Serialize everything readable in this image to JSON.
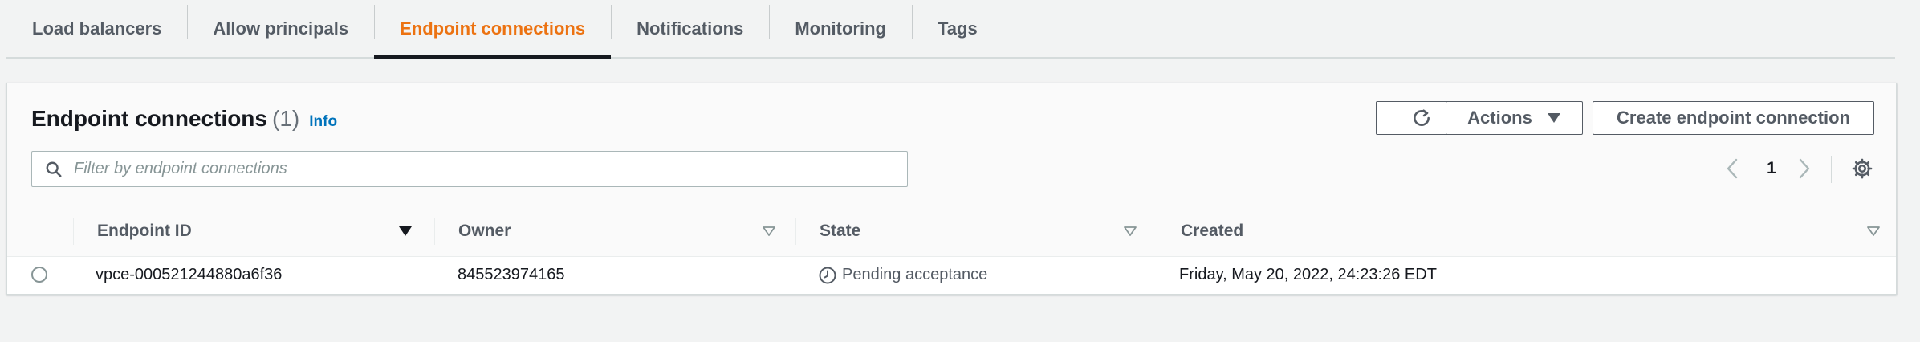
{
  "tabs": [
    {
      "label": "Load balancers",
      "active": false
    },
    {
      "label": "Allow principals",
      "active": false
    },
    {
      "label": "Endpoint connections",
      "active": true
    },
    {
      "label": "Notifications",
      "active": false
    },
    {
      "label": "Monitoring",
      "active": false
    },
    {
      "label": "Tags",
      "active": false
    }
  ],
  "panel": {
    "title": "Endpoint connections",
    "count": "(1)",
    "info": "Info"
  },
  "toolbar": {
    "refresh_icon": "refresh-icon",
    "actions_label": "Actions",
    "create_label": "Create endpoint connection"
  },
  "search": {
    "placeholder": "Filter by endpoint connections",
    "value": ""
  },
  "pagination": {
    "current_page": "1"
  },
  "table": {
    "columns": [
      "Endpoint ID",
      "Owner",
      "State",
      "Created"
    ],
    "rows": [
      {
        "endpoint_id": "vpce-000521244880a6f36",
        "owner": "845523974165",
        "state": "Pending acceptance",
        "created": "Friday, May 20, 2022, 24:23:26 EDT"
      }
    ]
  },
  "colors": {
    "accent": "#ec7211",
    "link": "#0073bb",
    "text": "#16191f",
    "muted": "#545b64"
  }
}
